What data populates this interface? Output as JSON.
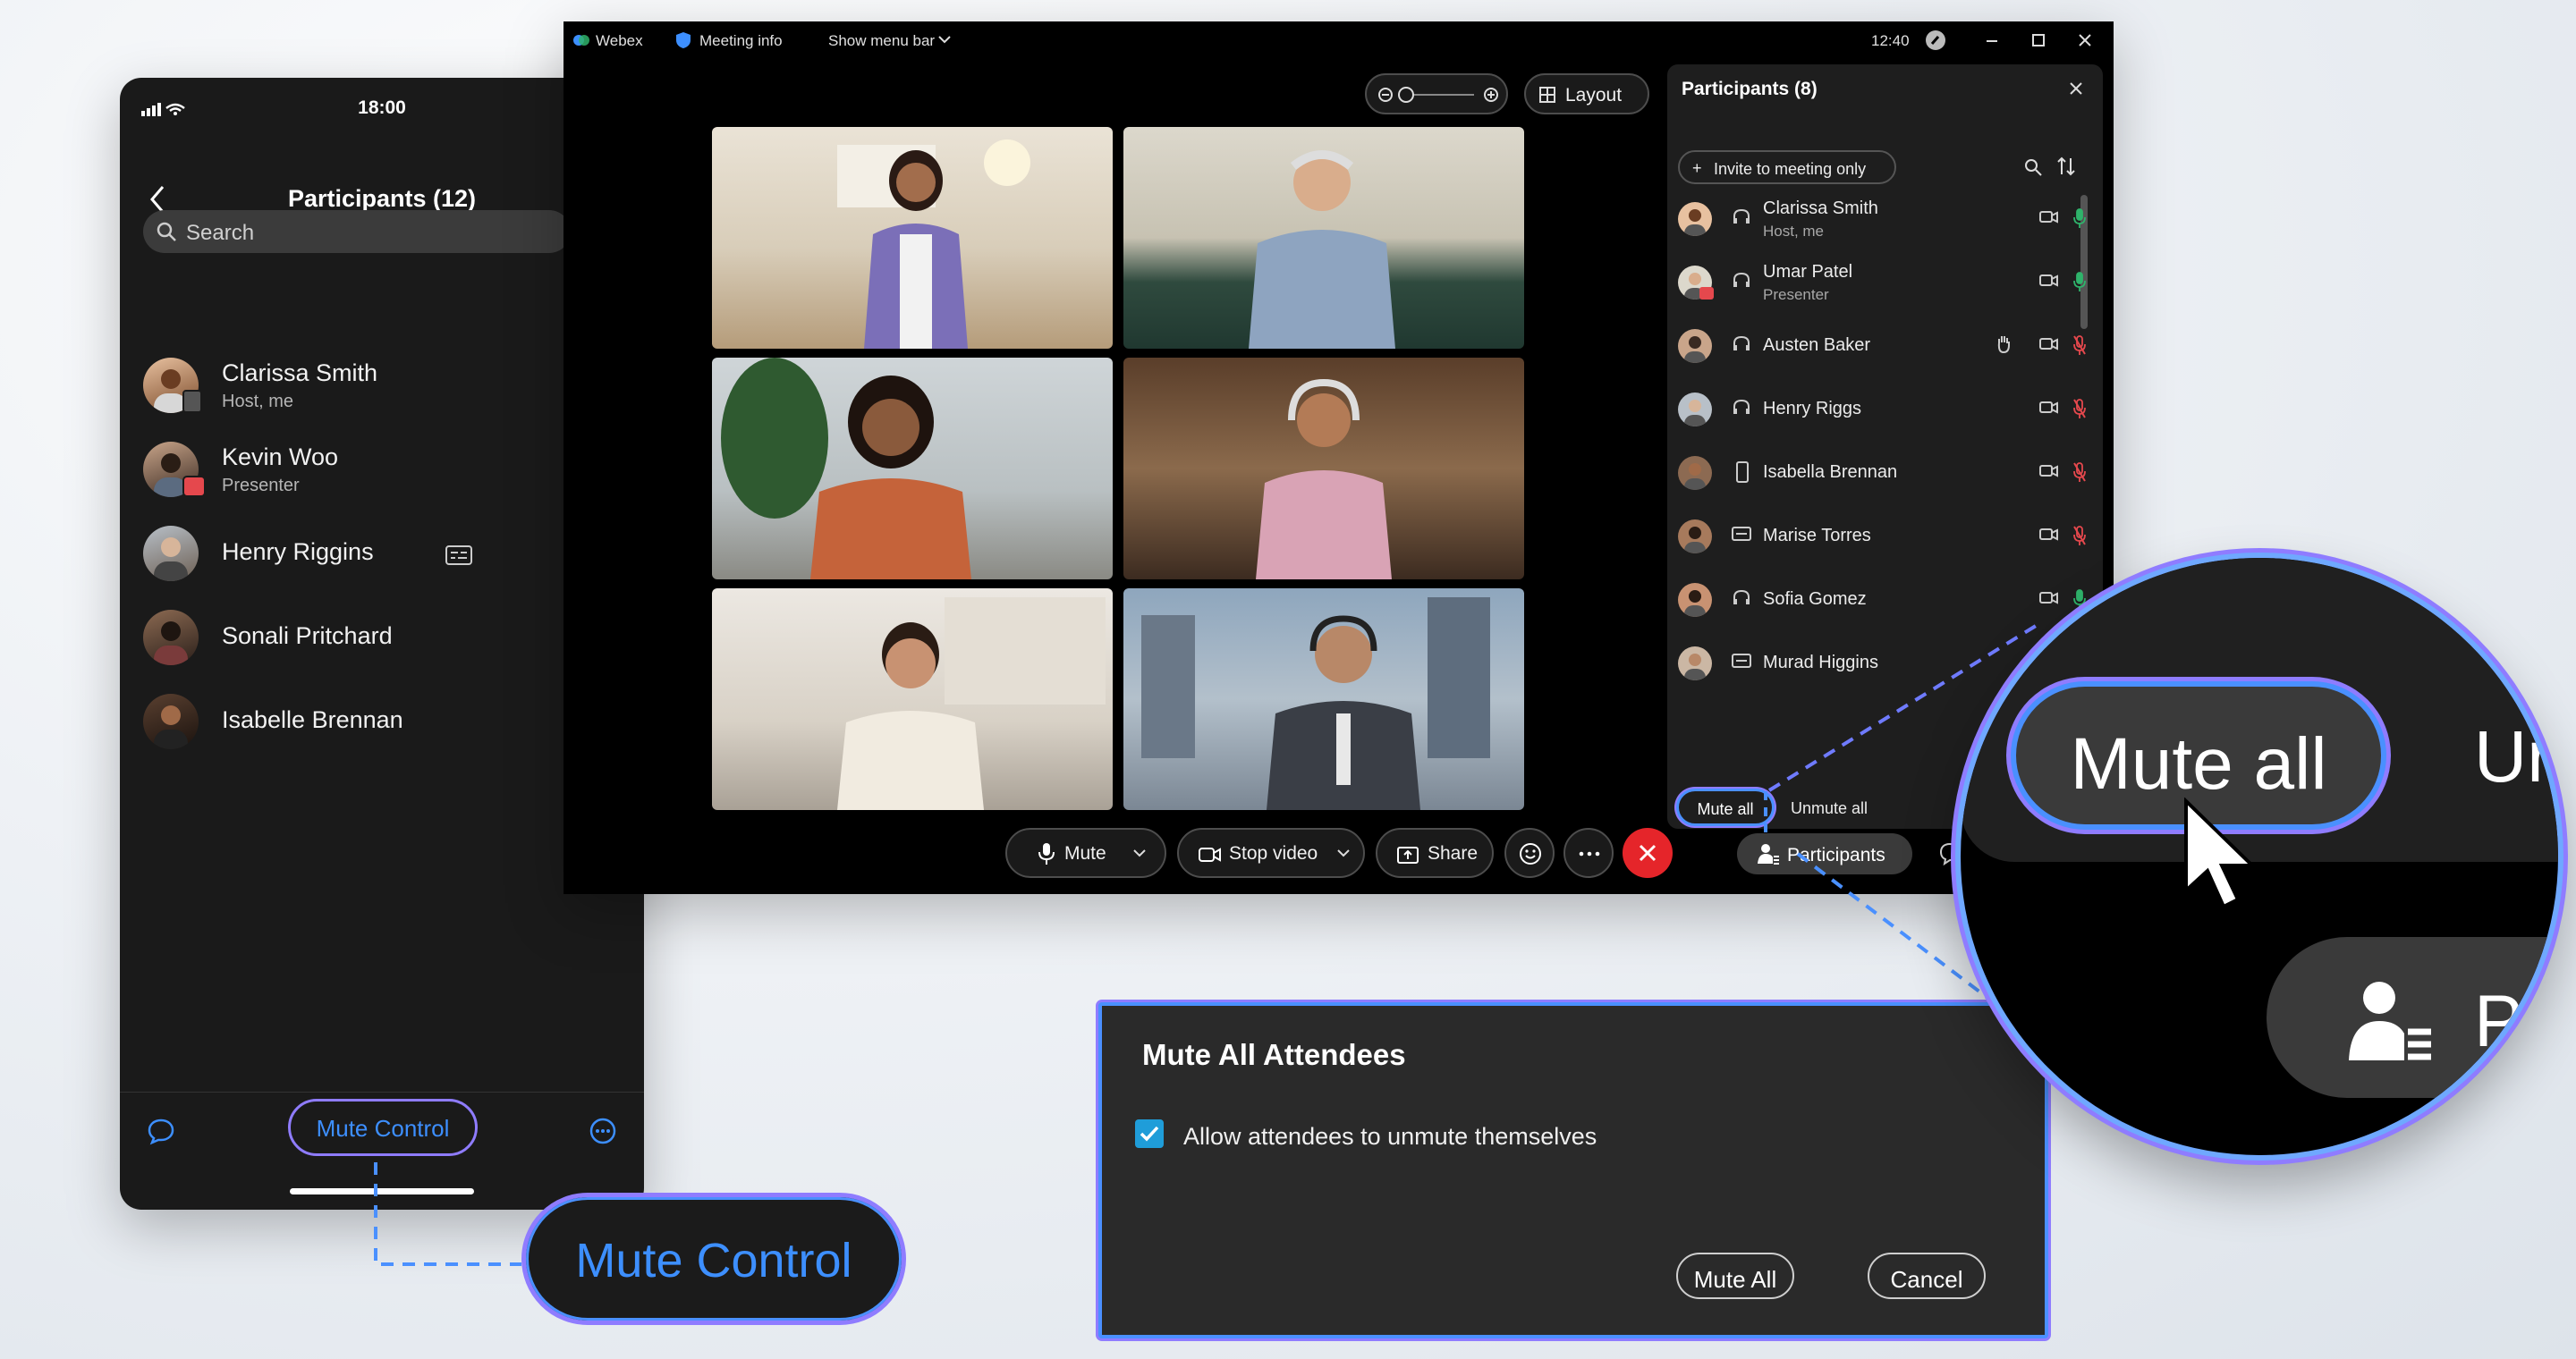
{
  "mobile": {
    "status_time": "18:00",
    "title": "Participants (12)",
    "search_placeholder": "Search",
    "participants": [
      {
        "name": "Clarissa Smith",
        "role": "Host, me",
        "mic": "muted"
      },
      {
        "name": "Kevin Woo",
        "role": "Presenter",
        "mic": "unmuted"
      },
      {
        "name": "Henry Riggins",
        "role": "",
        "mic": "unmuted"
      },
      {
        "name": "Sonali Pritchard",
        "role": "",
        "mic": "unmuted"
      },
      {
        "name": "Isabelle Brennan",
        "role": "",
        "mic": "unmuted"
      }
    ],
    "footer_button": "Mute Control"
  },
  "callout_mute_control": "Mute Control",
  "desktop": {
    "app_name": "Webex",
    "meeting_info": "Meeting info",
    "show_menu_bar": "Show menu bar",
    "time": "12:40",
    "layout_button": "Layout",
    "controls": {
      "mute": "Mute",
      "stop_video": "Stop video",
      "share": "Share",
      "participants": "Participants"
    },
    "panel": {
      "title": "Participants (8)",
      "invite_button": "Invite to meeting only",
      "participants": [
        {
          "name": "Clarissa Smith",
          "role": "Host, me",
          "mic": "unmuted"
        },
        {
          "name": "Umar Patel",
          "role": "Presenter",
          "mic": "unmuted"
        },
        {
          "name": "Austen Baker",
          "role": "",
          "mic": "muted"
        },
        {
          "name": "Henry Riggs",
          "role": "",
          "mic": "muted"
        },
        {
          "name": "Isabella Brennan",
          "role": "",
          "mic": "muted"
        },
        {
          "name": "Marise Torres",
          "role": "",
          "mic": "muted"
        },
        {
          "name": "Sofia Gomez",
          "role": "",
          "mic": "unmuted"
        },
        {
          "name": "Murad Higgins",
          "role": "",
          "mic": "muted"
        }
      ],
      "mute_all": "Mute all",
      "unmute_all": "Unmute all"
    }
  },
  "dialog": {
    "title": "Mute All Attendees",
    "checkbox_label": "Allow attendees to unmute themselves",
    "checkbox_checked": true,
    "confirm": "Mute All",
    "cancel": "Cancel"
  },
  "magnifier": {
    "button": "Mute all",
    "clipped_text": "Ur",
    "clipped_text2": "P"
  },
  "colors": {
    "accent_blue": "#3d8fff",
    "accent_purple": "#8f7cff",
    "mic_green": "#2fb36b",
    "mic_red": "#e5484d",
    "end_call": "#e5252a"
  }
}
